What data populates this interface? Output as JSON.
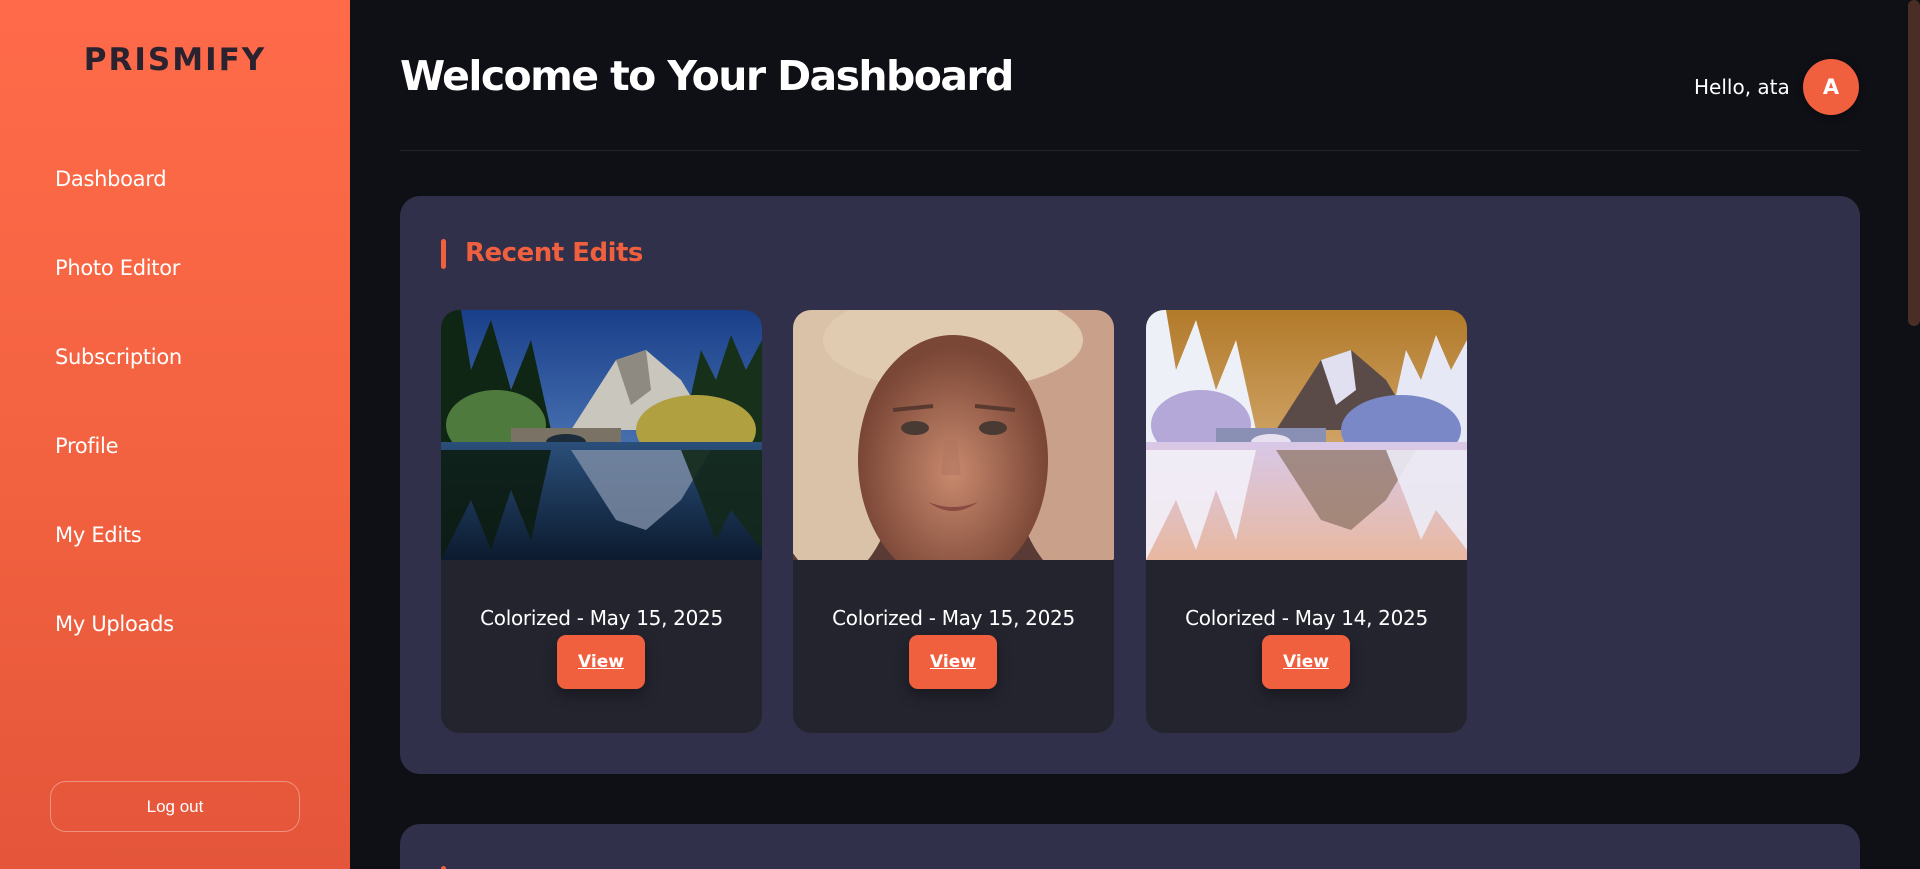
{
  "app": {
    "brand": "PRISMIFY"
  },
  "sidebar": {
    "items": [
      {
        "label": "Dashboard"
      },
      {
        "label": "Photo Editor"
      },
      {
        "label": "Subscription"
      },
      {
        "label": "Profile"
      },
      {
        "label": "My Edits"
      },
      {
        "label": "My Uploads"
      }
    ],
    "logout_label": "Log out"
  },
  "header": {
    "title": "Welcome to Your Dashboard",
    "greeting": "Hello, ata",
    "avatar_initial": "A"
  },
  "recent_edits": {
    "title": "Recent Edits",
    "cards": [
      {
        "caption": "Colorized - May 15, 2025",
        "button": "View",
        "image": "mountain-lake-bridge-photo"
      },
      {
        "caption": "Colorized - May 15, 2025",
        "button": "View",
        "image": "woman-portrait-photo"
      },
      {
        "caption": "Colorized - May 14, 2025",
        "button": "View",
        "image": "inverted-mountain-lake-photo"
      }
    ]
  },
  "colors": {
    "accent": "#f0603f",
    "sidebar_top": "#ff6b4a",
    "background": "#0f1016",
    "panel": "#30304a",
    "card": "#24242f"
  }
}
